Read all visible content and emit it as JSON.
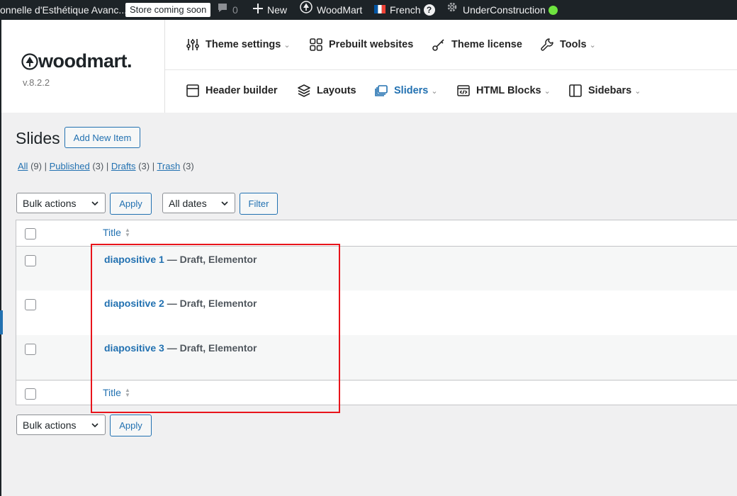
{
  "admin_bar": {
    "site_name": "onnelle d'Esthétique Avanc...",
    "store_badge": "Store coming soon",
    "comments_count": "0",
    "new_label": "New",
    "woodmart_label": "WoodMart",
    "language_label": "French",
    "language_help": "?",
    "under_construction_label": "UnderConstruction",
    "status_color": "#6ee33f"
  },
  "plugin_header": {
    "logo_text": "woodmart.",
    "version": "v.8.2.2",
    "nav_row1": [
      {
        "label": "Theme settings",
        "icon": "sliders-icon",
        "dropdown": true
      },
      {
        "label": "Prebuilt websites",
        "icon": "grid-icon",
        "dropdown": false
      },
      {
        "label": "Theme license",
        "icon": "key-icon",
        "dropdown": false
      },
      {
        "label": "Tools",
        "icon": "wrench-icon",
        "dropdown": true
      }
    ],
    "nav_row2": [
      {
        "label": "Header builder",
        "icon": "header-icon",
        "dropdown": false
      },
      {
        "label": "Layouts",
        "icon": "layers-icon",
        "dropdown": false
      },
      {
        "label": "Sliders",
        "icon": "sliders-stack-icon",
        "dropdown": true,
        "active": true
      },
      {
        "label": "HTML Blocks",
        "icon": "code-block-icon",
        "dropdown": true
      },
      {
        "label": "Sidebars",
        "icon": "sidebar-icon",
        "dropdown": true
      }
    ],
    "accent_color": "#2271b1"
  },
  "page": {
    "title": "Slides",
    "add_new_label": "Add New Item",
    "filters": {
      "all": {
        "label": "All",
        "count": "(9)"
      },
      "published": {
        "label": "Published",
        "count": "(3)"
      },
      "drafts": {
        "label": "Drafts",
        "count": "(3)"
      },
      "trash": {
        "label": "Trash",
        "count": "(3)"
      },
      "separator": "|"
    },
    "bulk_actions_label": "Bulk actions",
    "apply_label": "Apply",
    "dates_label": "All dates",
    "filter_label": "Filter"
  },
  "table": {
    "column_title": "Title",
    "rows": [
      {
        "title": "diapositive 1",
        "state": " — Draft, Elementor"
      },
      {
        "title": "diapositive 2",
        "state": " — Draft, Elementor"
      },
      {
        "title": "diapositive 3",
        "state": " — Draft, Elementor"
      }
    ]
  },
  "highlight_color": "#e8141b"
}
